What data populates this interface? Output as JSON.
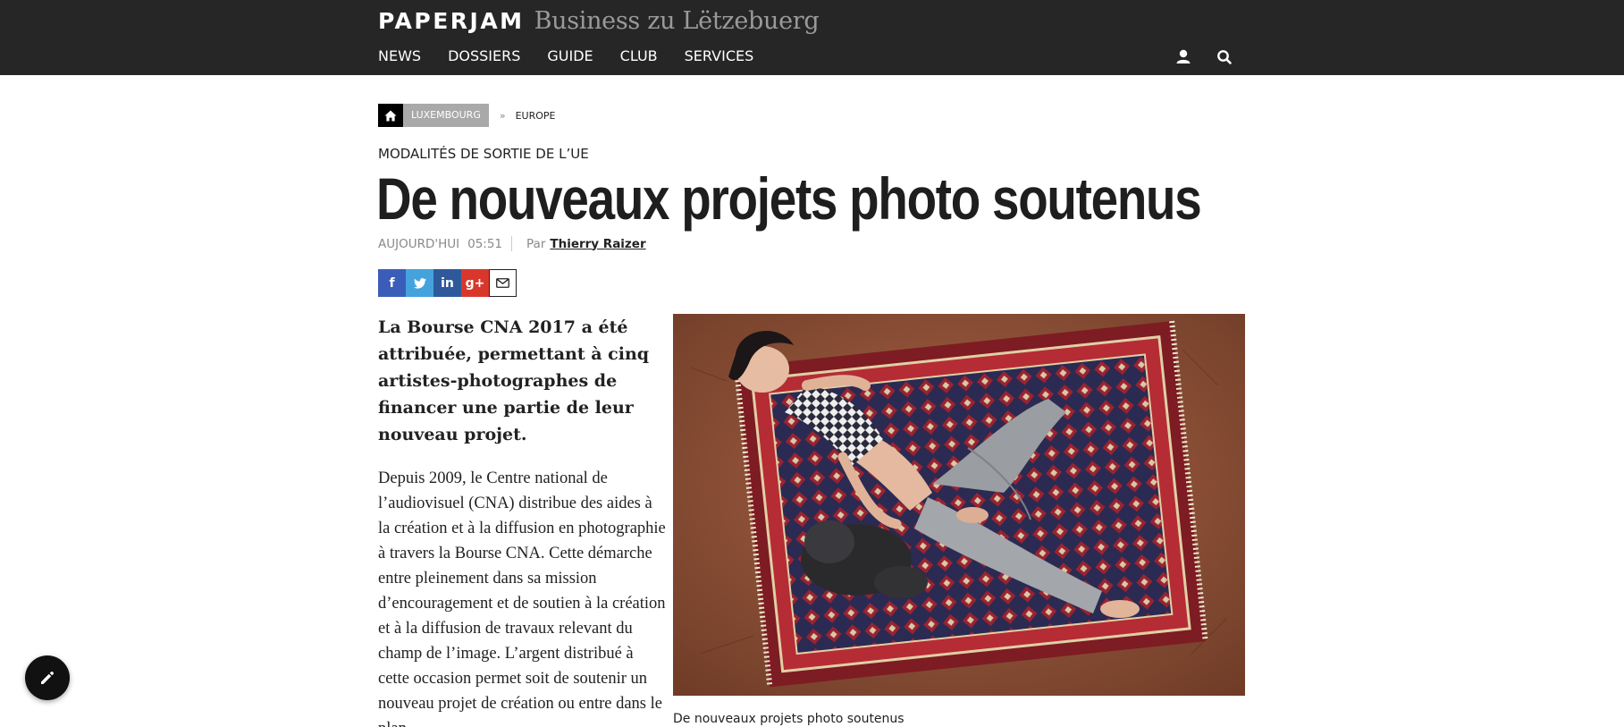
{
  "header": {
    "logo": "PAPERJAM",
    "tagline": "Business zu Lëtzebuerg",
    "nav": [
      "NEWS",
      "DOSSIERS",
      "GUIDE",
      "CLUB",
      "SERVICES"
    ],
    "icons": {
      "account": "user-icon",
      "search": "search-icon"
    }
  },
  "breadcrumb": {
    "home_icon": "home-icon",
    "current": "LUXEMBOURG",
    "separator": "»",
    "item": "EUROPE"
  },
  "article": {
    "kicker": "MODALITÉS DE SORTIE DE L’UE",
    "title": "De nouveaux projets photo soutenus",
    "date": "AUJOURD'HUI",
    "time": "05:51",
    "by": "Par",
    "author": "Thierry Raizer",
    "lead": "La Bourse CNA 2017 a été attribuée, permettant à cinq artistes-photographes de financer une partie de leur nouveau projet.",
    "body": "Depuis 2009, le Centre national de l’audiovisuel (CNA) distribue des aides à la création et à la diffusion en photographie à travers la Bourse CNA. Cette démarche entre pleinement dans sa mission d’encouragement et de soutien à la création et à la diffusion de travaux relevant du champ de l’image. L’argent distribué à cette occasion permet soit de soutenir un nouveau projet de création ou entre dans le plan",
    "photo_caption": "De nouveaux projets photo soutenus"
  },
  "share": [
    {
      "name": "facebook",
      "glyph": "f",
      "color": "#3b5dba"
    },
    {
      "name": "twitter",
      "glyph": "t",
      "color": "#44a3dd"
    },
    {
      "name": "linkedin",
      "glyph": "in",
      "color": "#2e5a9c"
    },
    {
      "name": "googleplus",
      "glyph": "g+",
      "color": "#d9372c"
    },
    {
      "name": "email",
      "glyph": "",
      "color": "#ffffff"
    }
  ],
  "fab": {
    "icon": "pencil-icon"
  }
}
